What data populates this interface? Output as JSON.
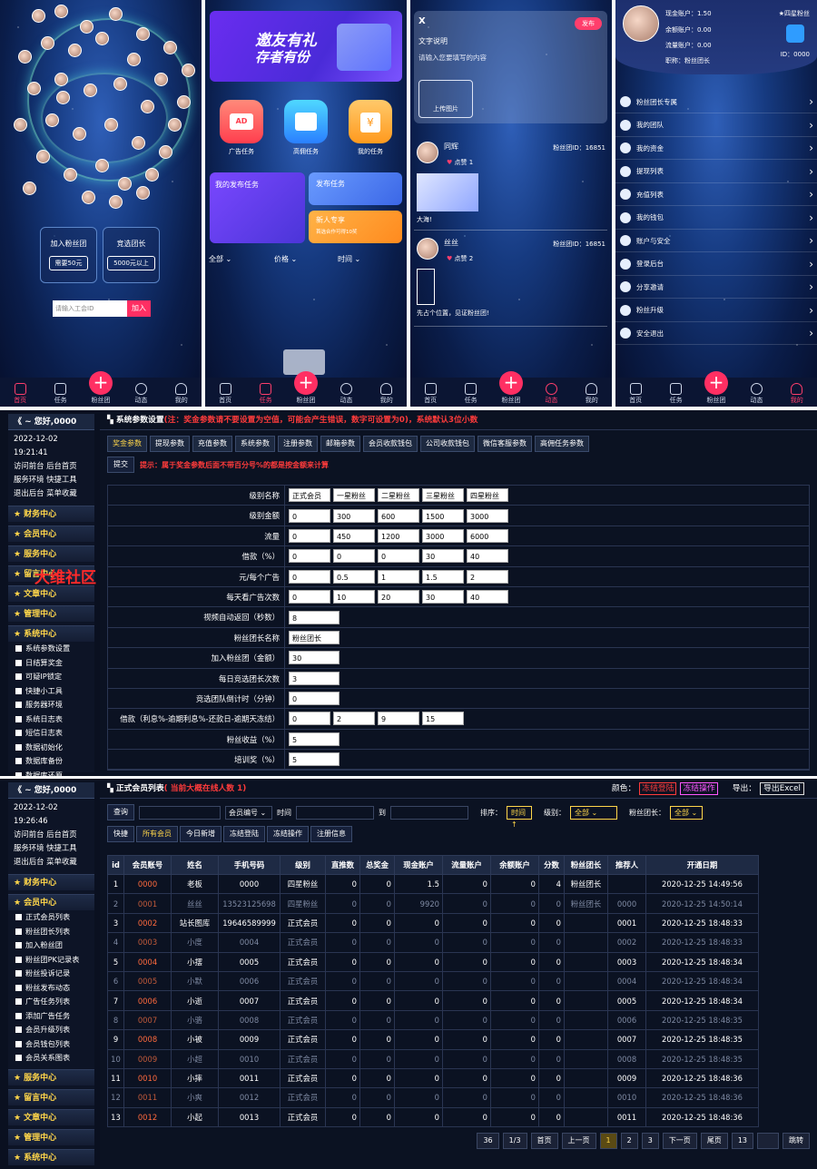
{
  "phone1": {
    "join_label": "加入粉丝团",
    "join_price": "需要50元",
    "elect_label": "竞选团长",
    "elect_price": "5000元以上",
    "input_placeholder": "请输入工会ID",
    "join_button": "加入"
  },
  "phone2": {
    "banner_line1": "邀友有礼",
    "banner_line2": "存者有份",
    "icon_ad": "广告任务",
    "icon_high": "高佣任务",
    "icon_mine": "我的任务",
    "ad_badge": "AD",
    "card_my_publish": "我的发布任务",
    "card_publish": "发布任务",
    "card_newbie": "新人专享",
    "card_newbie_sub": "首选合作可得10奖",
    "filter_all": "全部",
    "filter_price": "价格",
    "filter_time": "时间"
  },
  "phone3": {
    "close": "X",
    "publish_button": "发布",
    "text_label": "文字说明",
    "text_placeholder": "请输入您要填写的内容",
    "upload_label": "上传图片",
    "posts": [
      {
        "name": "同辉",
        "likes": "点赞 1",
        "fan_id": "粉丝团ID：16851",
        "caption": "大海!"
      },
      {
        "name": "丝丝",
        "likes": "点赞 2",
        "fan_id": "粉丝团ID：16851",
        "caption": "先占个位置，见证粉丝团!"
      }
    ]
  },
  "phone4": {
    "cash": "现金账户：1.50",
    "balance": "余额账户：0.00",
    "flow": "流量账户：0.00",
    "title": "职称：粉丝团长",
    "level": "四星粉丝",
    "id": "ID：0000",
    "menu": [
      "粉丝团长专属",
      "我的团队",
      "我的资金",
      "提现列表",
      "充值列表",
      "我的钱包",
      "账户与安全",
      "登录后台",
      "分享邀请",
      "粉丝升级",
      "安全退出"
    ]
  },
  "bottom_nav": {
    "p1": [
      "首页",
      "任务",
      "粉丝团",
      "动态",
      "我的"
    ],
    "active": [
      0,
      1,
      3,
      4
    ]
  },
  "admin1": {
    "greeting": "《 ~ 您好,0000",
    "datetime": "2022-12-02 19:21:41",
    "links": [
      "访问前台 后台首页",
      "服务环境 快捷工具",
      "退出后台 菜单收藏"
    ],
    "sections_top": [
      "财务中心",
      "会员中心",
      "服务中心",
      "留言中心",
      "文章中心",
      "管理中心",
      "系统中心"
    ],
    "watermark": "大维社区",
    "sub_items": [
      "系统参数设置",
      "日结算奖金",
      "可疑IP锁定",
      "快捷小工具",
      "服务器环境",
      "系统日志表",
      "短信日志表",
      "数据初始化",
      "数据库备份",
      "数据库还原"
    ],
    "title": "系统参数设置",
    "title_note": "(注：奖金参数请不要设置为空值，可能会产生错误，数字可设置为0)，系统默认3位小数",
    "tabs": [
      "奖金参数",
      "提现参数",
      "充值参数",
      "系统参数",
      "注册参数",
      "邮箱参数",
      "会员收款钱包",
      "公司收款钱包",
      "微信客服参数",
      "高佣任务参数"
    ],
    "submit": "提交",
    "hint": "提示：属于奖金参数后面不带百分号%的都是按金额来计算",
    "rows": [
      {
        "k": "级别名称",
        "v": [
          "正式会员",
          "一星粉丝",
          "二星粉丝",
          "三星粉丝",
          "四星粉丝"
        ]
      },
      {
        "k": "级别金额",
        "v": [
          "0",
          "300",
          "600",
          "1500",
          "3000"
        ]
      },
      {
        "k": "流量",
        "v": [
          "0",
          "450",
          "1200",
          "3000",
          "6000"
        ]
      },
      {
        "k": "借款（%）",
        "v": [
          "0",
          "0",
          "0",
          "30",
          "40"
        ]
      },
      {
        "k": "元/每个广告",
        "v": [
          "0",
          "0.5",
          "1",
          "1.5",
          "2"
        ]
      },
      {
        "k": "每天看广告次数",
        "v": [
          "0",
          "10",
          "20",
          "30",
          "40"
        ]
      },
      {
        "k": "视频自动返回（秒数）",
        "v": [
          "8"
        ]
      },
      {
        "k": "粉丝团长名称",
        "v": [
          "粉丝团长"
        ]
      },
      {
        "k": "加入粉丝团（金额）",
        "v": [
          "30"
        ]
      },
      {
        "k": "每日竞选团长次数",
        "v": [
          "3"
        ]
      },
      {
        "k": "竞选团队倒计时（分钟）",
        "v": [
          "0"
        ]
      },
      {
        "k": "借款（利息%-逾期利息%-还款日-逾期天冻结）",
        "v": [
          "0",
          "2",
          "9",
          "15"
        ]
      },
      {
        "k": "粉丝收益（%）",
        "v": [
          "5"
        ]
      },
      {
        "k": "培训奖（%）",
        "v": [
          "5"
        ]
      }
    ]
  },
  "admin2": {
    "greeting": "《 ~ 您好,0000",
    "datetime": "2022-12-02 19:26:46",
    "links": [
      "访问前台 后台首页",
      "服务环境 快捷工具",
      "退出后台 菜单收藏"
    ],
    "sections_top": [
      "财务中心",
      "会员中心"
    ],
    "sub_items": [
      "正式会员列表",
      "粉丝团长列表",
      "加入粉丝团",
      "粉丝团PK记录表",
      "粉丝投诉记录",
      "粉丝发布动态",
      "广告任务列表",
      "添加广告任务",
      "会员升级列表",
      "会员钱包列表",
      "会员关系图表"
    ],
    "sections_bottom": [
      "服务中心",
      "留言中心",
      "文章中心",
      "管理中心",
      "系统中心"
    ],
    "title": "正式会员列表",
    "title_note": "( 当前大概在线人数 1)",
    "color_label": "颜色：",
    "legend_frozen": "冻结登陆",
    "legend_op": "冻结操作",
    "export_label": "导出：",
    "export_btn": "导出Excel",
    "query": "查询",
    "member_select": "会员编号",
    "time_label": "时间",
    "to_label": "到",
    "sort_label": "排序：",
    "sort_val": "时间↑",
    "level_label": "级别：",
    "level_val": "全部",
    "leader_label": "粉丝团长：",
    "leader_val": "全部",
    "filter_tabs": [
      "快捷",
      "所有会员",
      "今日新增",
      "冻结登陆",
      "冻结操作",
      "注册信息"
    ],
    "headers": [
      "id",
      "会员账号",
      "姓名",
      "手机号码",
      "级别",
      "直推数",
      "总奖金",
      "现金账户",
      "流量账户",
      "余额账户",
      "分数",
      "粉丝团长",
      "推荐人",
      "开通日期"
    ],
    "rows": [
      [
        "1",
        "0000",
        "老板",
        "0000",
        "四星粉丝",
        "0",
        "0",
        "1.5",
        "0",
        "0",
        "4",
        "粉丝团长",
        "",
        "2020-12-25 14:49:56"
      ],
      [
        "2",
        "0001",
        "丝丝",
        "13523125698",
        "四星粉丝",
        "0",
        "0",
        "9920",
        "0",
        "0",
        "0",
        "粉丝团长",
        "0000",
        "2020-12-25 14:50:14"
      ],
      [
        "3",
        "0002",
        "站长图库",
        "19646589999",
        "正式会员",
        "0",
        "0",
        "0",
        "0",
        "0",
        "0",
        "",
        "0001",
        "2020-12-25 18:48:33"
      ],
      [
        "4",
        "0003",
        "小度",
        "0004",
        "正式会员",
        "0",
        "0",
        "0",
        "0",
        "0",
        "0",
        "",
        "0002",
        "2020-12-25 18:48:33"
      ],
      [
        "5",
        "0004",
        "小摆",
        "0005",
        "正式会员",
        "0",
        "0",
        "0",
        "0",
        "0",
        "0",
        "",
        "0003",
        "2020-12-25 18:48:34"
      ],
      [
        "6",
        "0005",
        "小默",
        "0006",
        "正式会员",
        "0",
        "0",
        "0",
        "0",
        "0",
        "0",
        "",
        "0004",
        "2020-12-25 18:48:34"
      ],
      [
        "7",
        "0006",
        "小逝",
        "0007",
        "正式会员",
        "0",
        "0",
        "0",
        "0",
        "0",
        "0",
        "",
        "0005",
        "2020-12-25 18:48:34"
      ],
      [
        "8",
        "0007",
        "小骆",
        "0008",
        "正式会员",
        "0",
        "0",
        "0",
        "0",
        "0",
        "0",
        "",
        "0006",
        "2020-12-25 18:48:35"
      ],
      [
        "9",
        "0008",
        "小被",
        "0009",
        "正式会员",
        "0",
        "0",
        "0",
        "0",
        "0",
        "0",
        "",
        "0007",
        "2020-12-25 18:48:35"
      ],
      [
        "10",
        "0009",
        "小超",
        "0010",
        "正式会员",
        "0",
        "0",
        "0",
        "0",
        "0",
        "0",
        "",
        "0008",
        "2020-12-25 18:48:35"
      ],
      [
        "11",
        "0010",
        "小摔",
        "0011",
        "正式会员",
        "0",
        "0",
        "0",
        "0",
        "0",
        "0",
        "",
        "0009",
        "2020-12-25 18:48:36"
      ],
      [
        "12",
        "0011",
        "小爽",
        "0012",
        "正式会员",
        "0",
        "0",
        "0",
        "0",
        "0",
        "0",
        "",
        "0010",
        "2020-12-25 18:48:36"
      ],
      [
        "13",
        "0012",
        "小起",
        "0013",
        "正式会员",
        "0",
        "0",
        "0",
        "0",
        "0",
        "0",
        "",
        "0011",
        "2020-12-25 18:48:36"
      ]
    ],
    "dim_rows": [
      1,
      3,
      5,
      7,
      9,
      11
    ],
    "pager": [
      "36",
      "1/3",
      "首页",
      "上一页",
      "1",
      "2",
      "3",
      "下一页",
      "尾页",
      "13",
      "",
      "跳转"
    ],
    "pager_current": 4
  }
}
